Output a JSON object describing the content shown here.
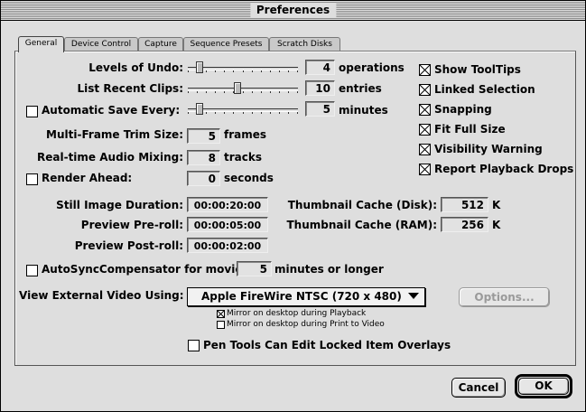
{
  "window": {
    "title": "Preferences"
  },
  "tabs": [
    "General",
    "Device Control",
    "Capture",
    "Sequence Presets",
    "Scratch Disks"
  ],
  "active_tab": "General",
  "sliders": {
    "undo": {
      "label": "Levels of Undo:",
      "value": "4",
      "unit": "operations",
      "level": 0.08
    },
    "recent": {
      "label": "List Recent Clips:",
      "value": "10",
      "unit": "entries",
      "level": 0.45
    },
    "autosave": {
      "label": "Automatic Save Every:",
      "value": "5",
      "unit": "minutes",
      "checked": false,
      "level": 0.08
    }
  },
  "fields": {
    "trim": {
      "label": "Multi-Frame Trim Size:",
      "value": "5",
      "unit": "frames"
    },
    "audio": {
      "label": "Real-time Audio Mixing:",
      "value": "8",
      "unit": "tracks"
    },
    "render": {
      "label": "Render Ahead:",
      "value": "0",
      "unit": "seconds",
      "checked": false
    },
    "still": {
      "label": "Still Image Duration:",
      "value": "00:00:20:00"
    },
    "preroll": {
      "label": "Preview Pre-roll:",
      "value": "00:00:05:00"
    },
    "postroll": {
      "label": "Preview Post-roll:",
      "value": "00:00:02:00"
    },
    "thumb_disk": {
      "label": "Thumbnail Cache (Disk):",
      "value": "512",
      "unit": "K"
    },
    "thumb_ram": {
      "label": "Thumbnail Cache (RAM):",
      "value": "256",
      "unit": "K"
    },
    "autosync": {
      "label": "AutoSyncCompensator for movies",
      "value": "5",
      "unit": "minutes or longer",
      "checked": false
    }
  },
  "options": [
    {
      "label": "Show ToolTips",
      "checked": true
    },
    {
      "label": "Linked Selection",
      "checked": true
    },
    {
      "label": "Snapping",
      "checked": true
    },
    {
      "label": "Fit Full Size",
      "checked": true
    },
    {
      "label": "Visibility Warning",
      "checked": true
    },
    {
      "label": "Report Playback Drops",
      "checked": true
    }
  ],
  "external_video": {
    "label": "View External Video Using:",
    "selected": "Apple FireWire NTSC (720 x 480)",
    "options_button": "Options...",
    "mirror_playback": {
      "label": "Mirror on desktop during Playback",
      "checked": true
    },
    "mirror_print": {
      "label": "Mirror on desktop during Print to Video",
      "checked": false
    }
  },
  "pen_tools": {
    "label": "Pen Tools Can Edit Locked Item Overlays",
    "checked": false
  },
  "buttons": {
    "cancel": "Cancel",
    "ok": "OK"
  }
}
